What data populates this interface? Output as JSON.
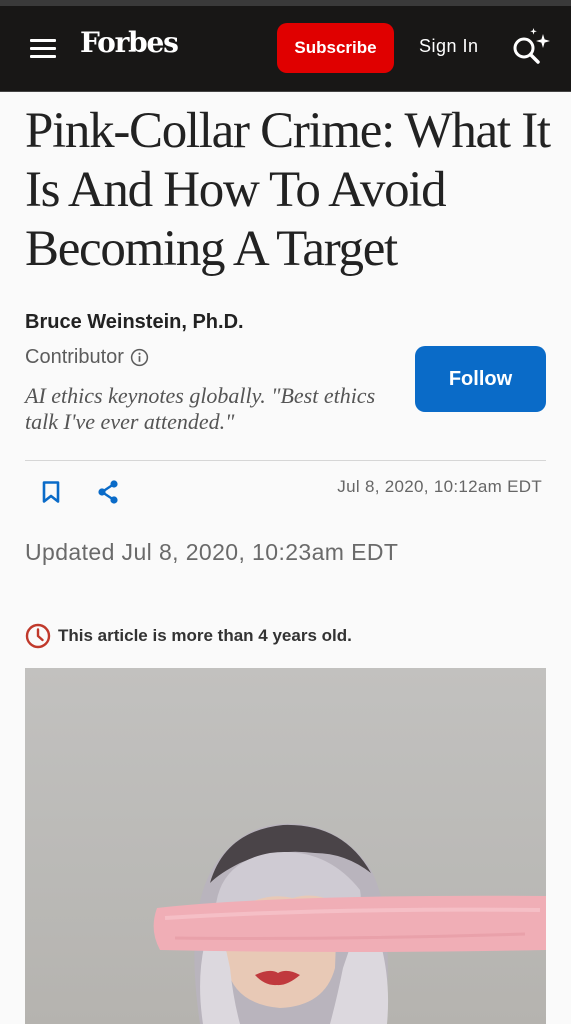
{
  "header": {
    "logo": "Forbes",
    "subscribe_label": "Subscribe",
    "signin_label": "Sign In",
    "icons": {
      "menu": "hamburger-menu-icon",
      "search": "search-sparkle-icon"
    },
    "colors": {
      "background": "#181716",
      "subscribe": "#e00000"
    }
  },
  "article": {
    "headline": "Pink-Collar Crime: What It Is And How To Avoid Becoming A Target",
    "author": {
      "name": "Bruce Weinstein, Ph.D.",
      "role": "Contributor",
      "bio": "AI ethics keynotes globally. \"Best ethics talk I've ever attended.\"",
      "follow_label": "Follow"
    },
    "published": "Jul 8, 2020, 10:12am EDT",
    "updated": "Updated Jul 8, 2020, 10:23am EDT",
    "age_notice": "This article is more than 4 years old.",
    "colors": {
      "follow": "#0a6bc8",
      "age_icon": "#c0392b"
    }
  }
}
